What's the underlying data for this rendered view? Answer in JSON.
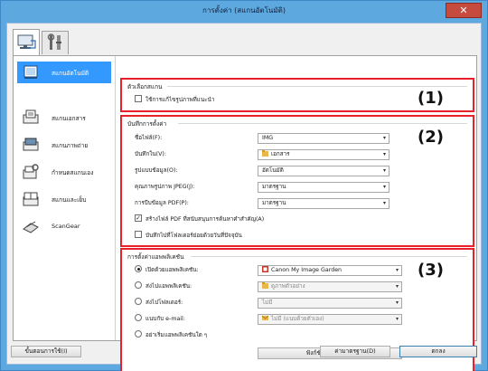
{
  "window": {
    "title": "การตั้งค่า (สแกนอัตโนมัติ)",
    "close_glyph": "✕"
  },
  "tabs": [
    {
      "icon": "scan-from-computer-icon"
    },
    {
      "icon": "general-settings-icon"
    }
  ],
  "sidebar": {
    "items": [
      {
        "label": "สแกนอัตโนมัติ",
        "icon": "auto-scan-icon",
        "selected": true
      },
      {
        "label": "สแกนเอกสาร",
        "icon": "document-scan-icon"
      },
      {
        "label": "สแกนภาพถ่าย",
        "icon": "photo-scan-icon"
      },
      {
        "label": "กำหนดสแกนเอง",
        "icon": "custom-scan-icon"
      },
      {
        "label": "สแกนและเย็บ",
        "icon": "scan-stitch-icon"
      },
      {
        "label": "ScanGear",
        "icon": "scangear-icon"
      }
    ]
  },
  "section1": {
    "title": "ตัวเลือกสแกน",
    "number": "(1)",
    "options": [
      {
        "label": "ใช้การแก้ไขรูปภาพที่แนะนำ",
        "checked": false
      }
    ]
  },
  "section2": {
    "title": "บันทึกการตั้งค่า",
    "number": "(2)",
    "fields": [
      {
        "label": "ชื่อไฟล์(F):",
        "value": "IMG",
        "icon": ""
      },
      {
        "label": "บันทึกใน(V):",
        "value": "เอกสาร",
        "icon": "folder-icon"
      },
      {
        "label": "รูปแบบข้อมูล(O):",
        "value": "อัตโนมัติ",
        "icon": ""
      },
      {
        "label": "คุณภาพรูปภาพ JPEG(J):",
        "value": "มาตรฐาน",
        "icon": ""
      },
      {
        "label": "การบีบข้อมูล PDF(P):",
        "value": "มาตรฐาน",
        "icon": ""
      }
    ],
    "checks": [
      {
        "label": "สร้างไฟล์ PDF ที่สนับสนุนการค้นหาคำสำคัญ(A)",
        "checked": true
      },
      {
        "label": "บันทึกไปที่โฟลเดอร์ย่อยด้วยวันที่ปัจจุบัน",
        "checked": false
      }
    ]
  },
  "section3": {
    "title": "การตั้งค่าแอพพลิเคชัน",
    "number": "(3)",
    "options": [
      {
        "label": "เปิดด้วยแอพพลิเคชัน:",
        "value": "Canon My Image Garden",
        "icon": "app-icon",
        "selected": true,
        "enabled": true
      },
      {
        "label": "ส่งไปแอพพลิเคชัน:",
        "value": "ดูภาพตัวอย่าง",
        "icon": "folder-icon",
        "selected": false,
        "enabled": false
      },
      {
        "label": "ส่งไปโฟลเดอร์:",
        "value": "ไม่มี",
        "icon": "",
        "selected": false,
        "enabled": false
      },
      {
        "label": "แนบกับ e-mail:",
        "value": "ไม่มี (แนบด้วยตัวเอง)",
        "icon": "mail-icon",
        "selected": false,
        "enabled": false
      },
      {
        "label": "อย่าเริ่มแอพพลิเคชันใด ๆ",
        "value": "",
        "icon": "",
        "selected": false,
        "enabled": false
      }
    ],
    "more_button": "ฟังก์ชันเพิ่มเติม(M)"
  },
  "footer": {
    "instructions_button": "ขั้นตอนการใช้(I)",
    "defaults_button": "ค่ามาตรฐาน(D)",
    "ok_button": "ตกลง"
  },
  "colors": {
    "selection": "#3399ff",
    "highlight_frame": "#e8202a",
    "titlebar": "#5ea8e0"
  }
}
